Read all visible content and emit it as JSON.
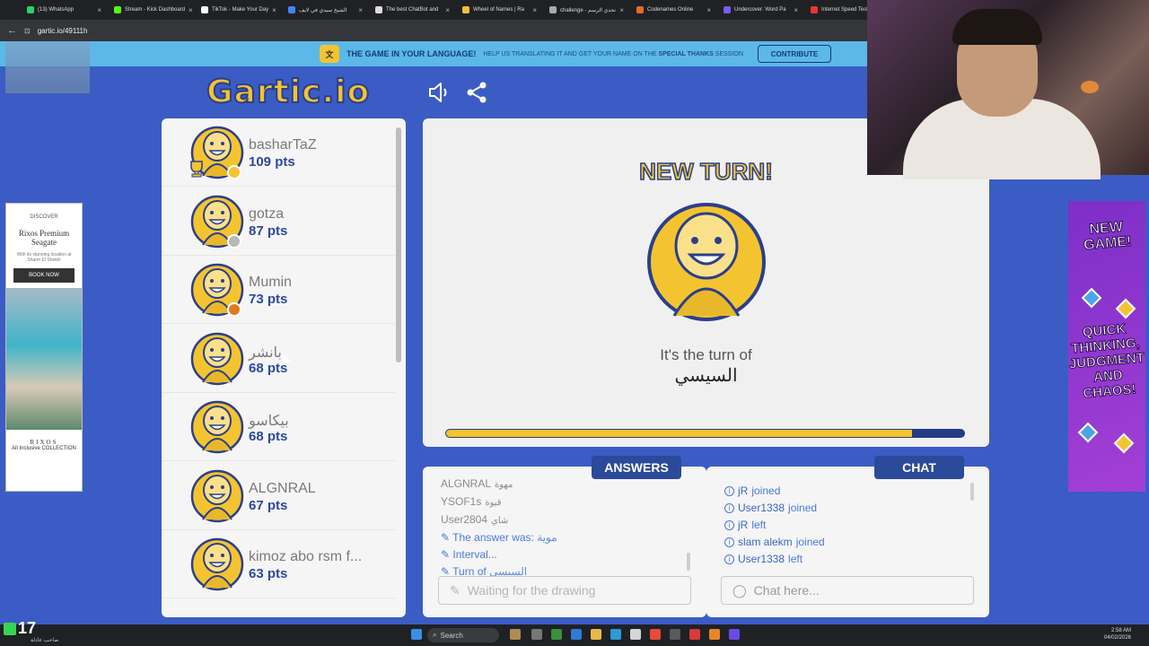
{
  "browser": {
    "tabs": [
      {
        "label": "(13) WhatsApp",
        "color": "#25d366"
      },
      {
        "label": "Stream - Kick Dashboard",
        "color": "#53fc18"
      },
      {
        "label": "TikTok - Make Your Day",
        "color": "#ffffff"
      },
      {
        "label": "الشيخ سيدي في لايف",
        "color": "#4285f4"
      },
      {
        "label": "The best ChatBot and",
        "color": "#dddddd"
      },
      {
        "label": "Wheel of Names | Ra",
        "color": "#f4c430"
      },
      {
        "label": "challenge - تحدي الرسم",
        "color": "#aaaaaa"
      },
      {
        "label": "Codenames Online",
        "color": "#e06c2c"
      },
      {
        "label": "Undercover: Word Pa",
        "color": "#7a5af8"
      },
      {
        "label": "Internet Speed Test |",
        "color": "#e33"
      }
    ],
    "url": "gartic.io/49111h"
  },
  "banner": {
    "title": "THE GAME IN YOUR LANGUAGE!",
    "text_before": "HELP US TRANSLATING IT AND GET YOUR NAME ON THE",
    "text_bold": "SPECIAL THANKS",
    "text_after": "SESSION",
    "contribute_label": "CONTRIBUTE"
  },
  "logo": "Gartic.io",
  "players": [
    {
      "name": "basharTaZ",
      "points": "109 pts",
      "status_color": "#f4c430",
      "trophy": true
    },
    {
      "name": "gotza",
      "points": "87 pts",
      "status_color": "#b8b8b8",
      "trophy": false
    },
    {
      "name": "Mumin",
      "points": "73 pts",
      "status_color": "#e07a1f",
      "trophy": false
    },
    {
      "name": "بانشر",
      "points": "68 pts",
      "status_color": "",
      "trophy": false
    },
    {
      "name": "بيكاسو",
      "points": "68 pts",
      "status_color": "",
      "trophy": false
    },
    {
      "name": "ALGNRAL",
      "points": "67 pts",
      "status_color": "",
      "trophy": false
    },
    {
      "name": "kimoz abo rsm f...",
      "points": "63 pts",
      "status_color": "",
      "trophy": false
    }
  ],
  "stage": {
    "heading": "NEW TURN!",
    "turn_label": "It's the turn of",
    "turn_player": "السيسي",
    "progress": 0.9
  },
  "answers": {
    "title": "ANSWERS",
    "lines": [
      {
        "user": "ALGNRAL",
        "text": "مهوة",
        "type": "user"
      },
      {
        "user": "YSOF1s",
        "text": "قيوة",
        "type": "user"
      },
      {
        "user": "User2804",
        "text": "شاي",
        "type": "user"
      },
      {
        "user": "",
        "text": "The answer was: ",
        "extra": "موية",
        "type": "system"
      },
      {
        "user": "",
        "text": "Interval...",
        "extra": "",
        "type": "system"
      },
      {
        "user": "",
        "text": "Turn of ",
        "extra": "السيسي",
        "type": "system"
      }
    ],
    "placeholder": "Waiting for the drawing"
  },
  "chat": {
    "title": "CHAT",
    "lines": [
      {
        "user": "jR",
        "action": "joined"
      },
      {
        "user": "User1338",
        "action": "joined"
      },
      {
        "user": "jR",
        "action": "left"
      },
      {
        "user": "slam alekm",
        "action": "joined"
      },
      {
        "user": "User1338",
        "action": "left"
      }
    ],
    "placeholder": "Chat here..."
  },
  "ads": {
    "left": {
      "label": "DISCOVER",
      "brand": "Rixos Premium Seagate",
      "desc": "With its stunning location at Sharm El Sheikh",
      "cta": "BOOK NOW",
      "logo": "RIXOS",
      "tagline": "All Inclusive COLLECTION"
    },
    "right": {
      "line1": "NEW GAME!",
      "line2": "QUICK THINKING, JUDGMENT AND CHAOS!"
    }
  },
  "overlay": {
    "counter": "17",
    "counter_label": "صاحب عادلة"
  },
  "taskbar": {
    "search": "Search",
    "time": "2:58 AM",
    "date": "04/02/2026"
  }
}
